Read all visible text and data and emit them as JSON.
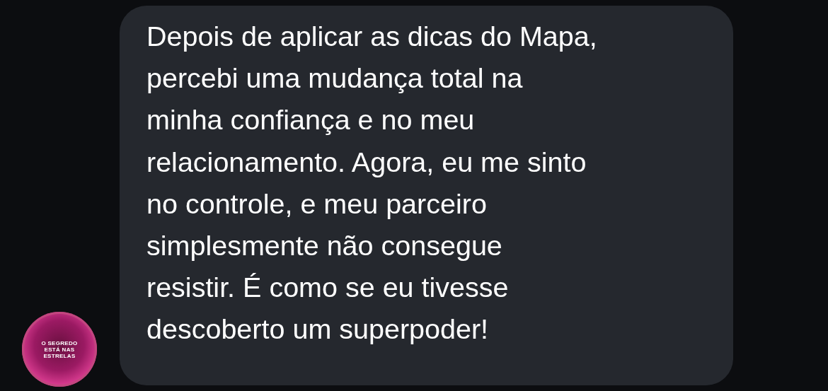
{
  "messages": [
    {
      "avatar": {
        "logo_text": "O SEGREDO\nESTÁ NAS\nESTRELAS"
      },
      "text": "Depois de aplicar as dicas do Mapa,\npercebi uma mudança total na\nminha confiança e no meu\nrelacionamento. Agora, eu me sinto\nno controle, e meu parceiro\nsimplesmente não consegue\nresistir. É como se eu tivesse\ndescoberto um superpoder!"
    }
  ]
}
